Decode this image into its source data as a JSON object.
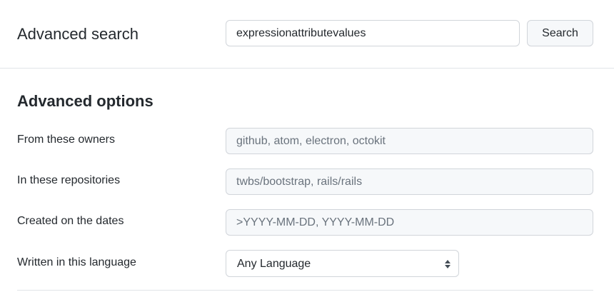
{
  "header": {
    "title": "Advanced search",
    "search_value": "expressionattributevalues",
    "search_button_label": "Search"
  },
  "advanced_options": {
    "title": "Advanced options",
    "owners": {
      "label": "From these owners",
      "placeholder": "github, atom, electron, octokit"
    },
    "repositories": {
      "label": "In these repositories",
      "placeholder": "twbs/bootstrap, rails/rails"
    },
    "dates": {
      "label": "Created on the dates",
      "placeholder": ">YYYY-MM-DD, YYYY-MM-DD"
    },
    "language": {
      "label": "Written in this language",
      "selected": "Any Language",
      "icon": "select-arrows-icon"
    }
  },
  "colors": {
    "text": "#24292e",
    "placeholder": "#6a737d",
    "border": "#d1d5da",
    "field_background": "#f6f8fa",
    "divider": "#e1e4e8"
  }
}
